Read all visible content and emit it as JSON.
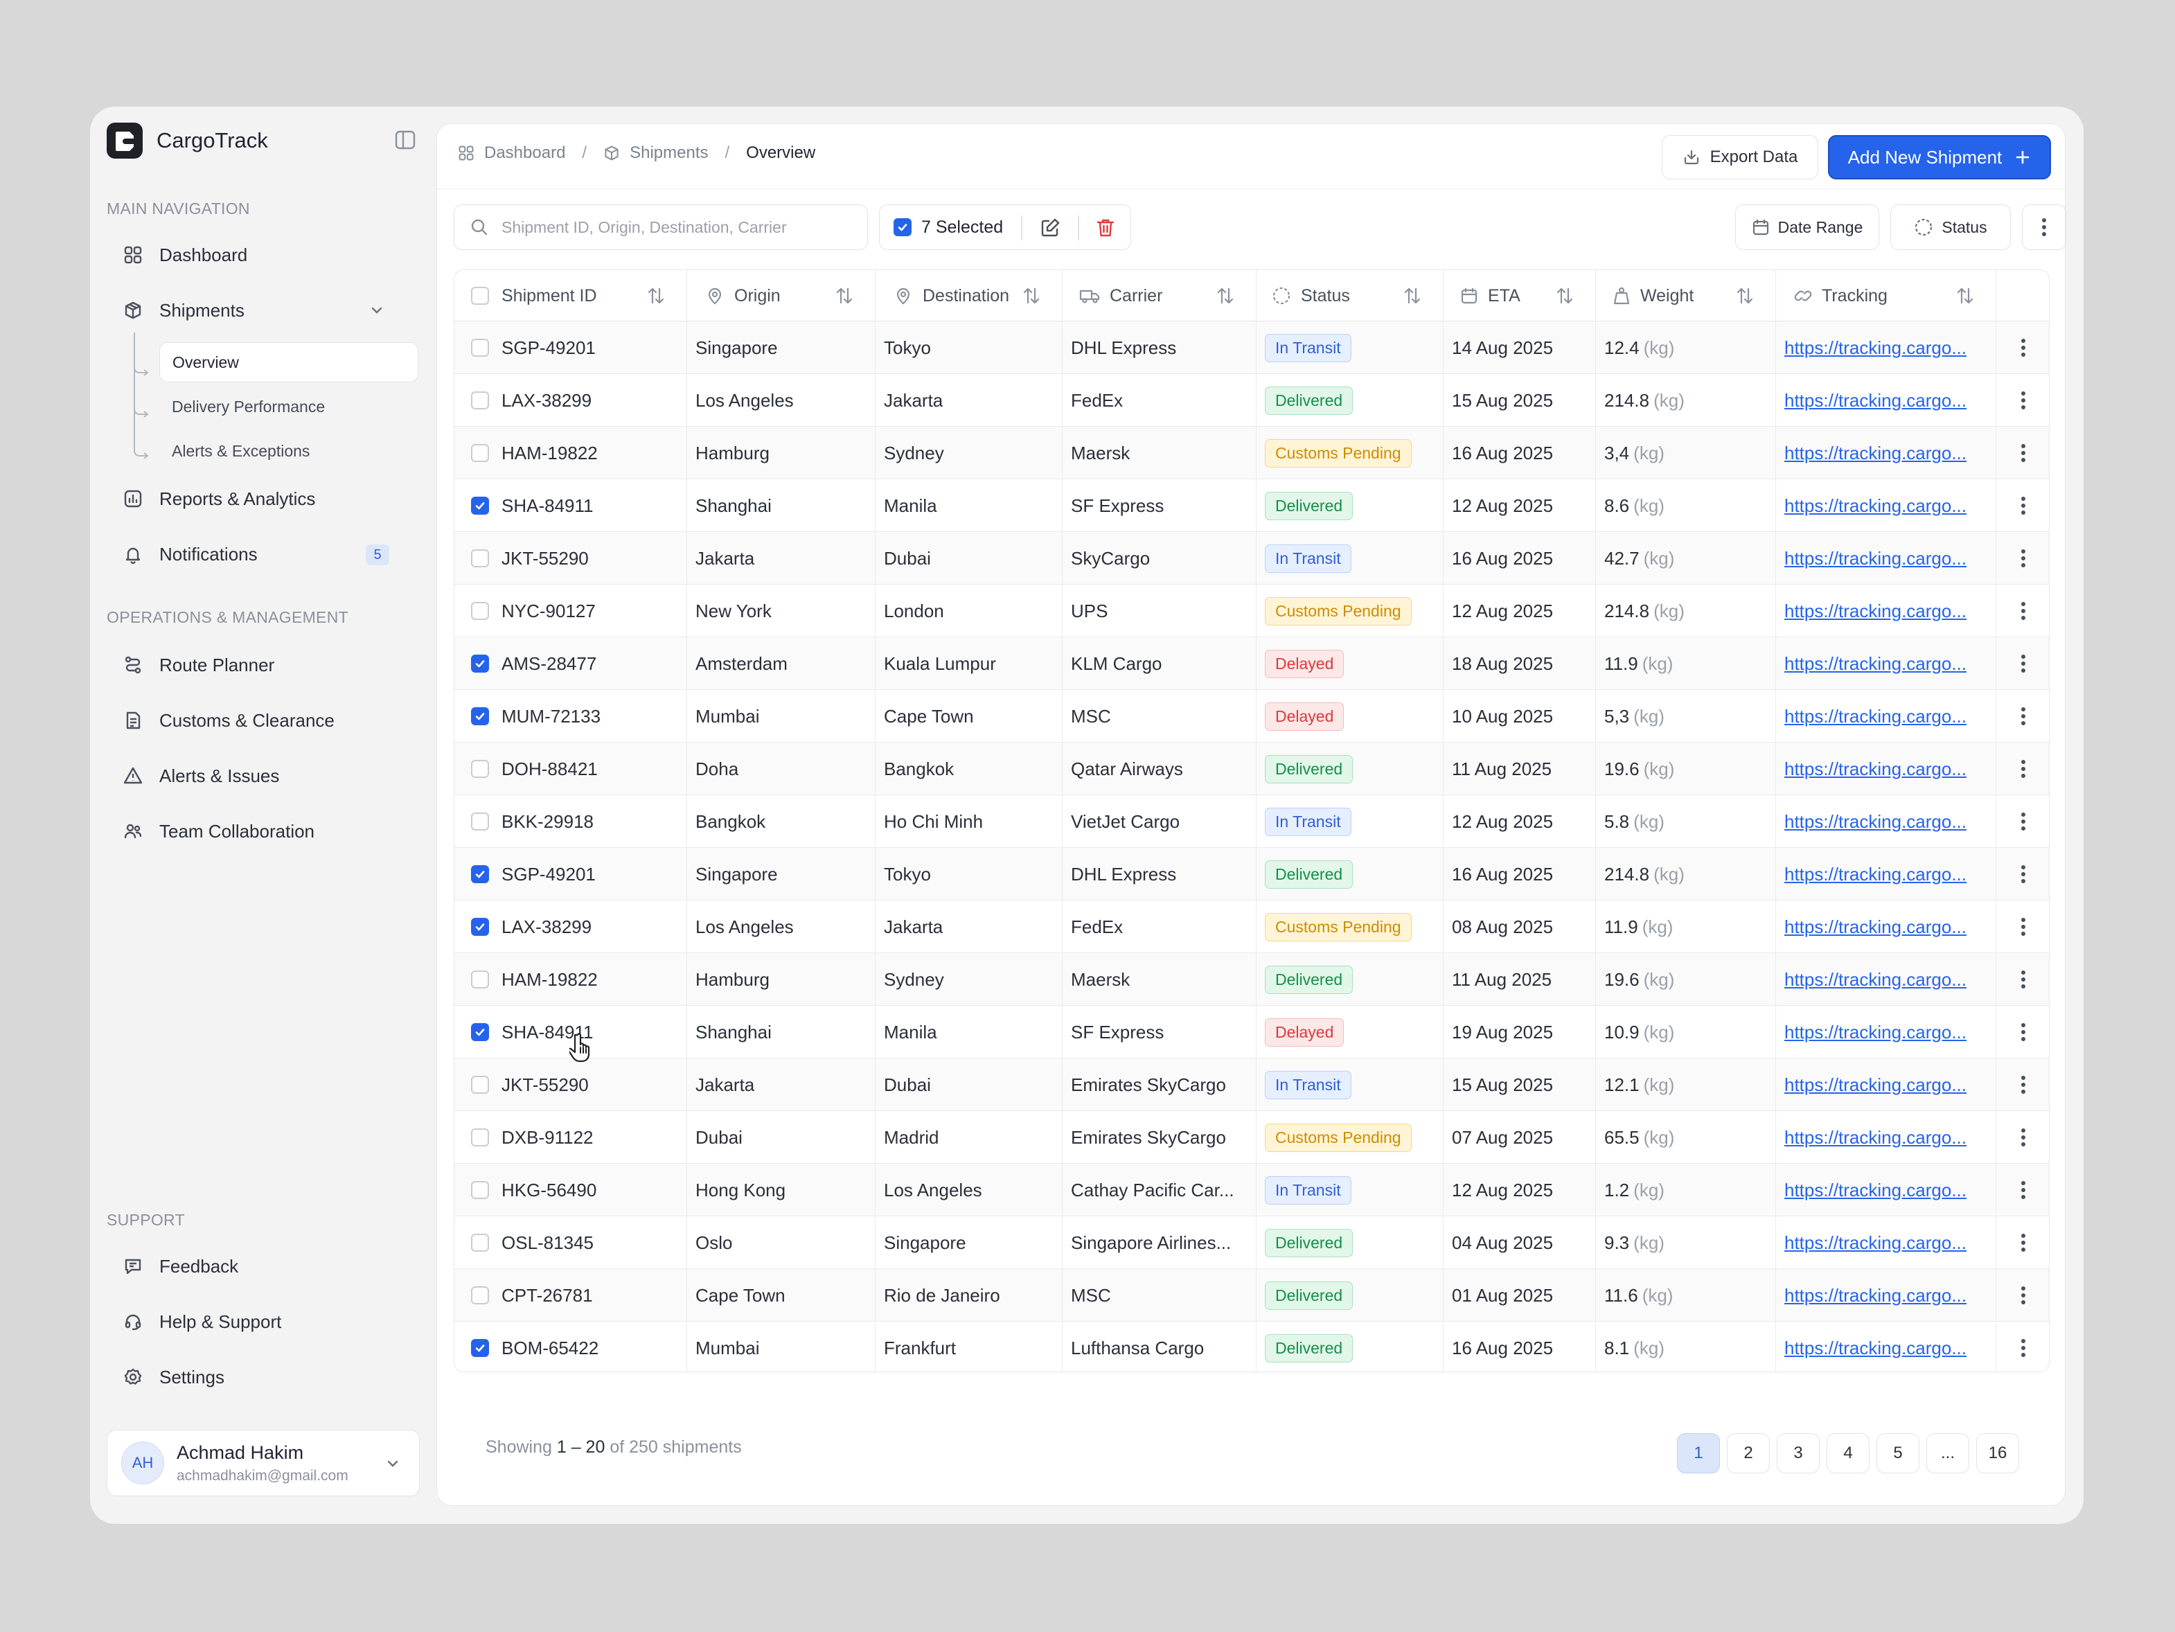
{
  "app": {
    "name": "CargoTrack"
  },
  "sidebar": {
    "main_nav_title": "MAIN NAVIGATION",
    "main_items": [
      {
        "label": "Dashboard",
        "icon": "grid-icon"
      },
      {
        "label": "Shipments",
        "icon": "package-icon"
      },
      {
        "label": "Reports & Analytics",
        "icon": "chart-icon"
      },
      {
        "label": "Notifications",
        "icon": "bell-icon",
        "badge": "5"
      }
    ],
    "shipments_sub": [
      {
        "label": "Overview",
        "active": true
      },
      {
        "label": "Delivery Performance"
      },
      {
        "label": "Alerts & Exceptions"
      }
    ],
    "ops_title": "OPERATIONS & MANAGEMENT",
    "ops_items": [
      {
        "label": "Route Planner",
        "icon": "route-icon"
      },
      {
        "label": "Customs & Clearance",
        "icon": "document-icon"
      },
      {
        "label": "Alerts & Issues",
        "icon": "warning-icon"
      },
      {
        "label": "Team Collaboration",
        "icon": "users-icon"
      }
    ],
    "support_title": "SUPPORT",
    "support_items": [
      {
        "label": "Feedback",
        "icon": "message-icon"
      },
      {
        "label": "Help & Support",
        "icon": "headset-icon"
      },
      {
        "label": "Settings",
        "icon": "gear-icon"
      }
    ],
    "profile": {
      "initials": "AH",
      "name": "Achmad Hakim",
      "email": "achmadhakim@gmail.com"
    }
  },
  "header": {
    "breadcrumb": [
      "Dashboard",
      "Shipments",
      "Overview"
    ],
    "export_label": "Export Data",
    "add_label": "Add New Shipment"
  },
  "toolbar": {
    "search_placeholder": "Shipment ID, Origin, Destination, Carrier",
    "selected_label": "7 Selected",
    "date_range_label": "Date Range",
    "status_label": "Status"
  },
  "table": {
    "columns": [
      "Shipment ID",
      "Origin",
      "Destination",
      "Carrier",
      "Status",
      "ETA",
      "Weight",
      "Tracking"
    ],
    "rows": [
      {
        "checked": false,
        "id": "SGP-49201",
        "origin": "Singapore",
        "dest": "Tokyo",
        "carrier": "DHL Express",
        "status": "In Transit",
        "eta": "14 Aug 2025",
        "weight": "12.4",
        "unit": "(kg)",
        "tracking": "https://tracking.cargo..."
      },
      {
        "checked": false,
        "id": "LAX-38299",
        "origin": "Los Angeles",
        "dest": "Jakarta",
        "carrier": "FedEx",
        "status": "Delivered",
        "eta": "15 Aug 2025",
        "weight": "214.8",
        "unit": "(kg)",
        "tracking": "https://tracking.cargo..."
      },
      {
        "checked": false,
        "id": "HAM-19822",
        "origin": "Hamburg",
        "dest": "Sydney",
        "carrier": "Maersk",
        "status": "Customs Pending",
        "eta": "16 Aug 2025",
        "weight": "3,4",
        "unit": "(kg)",
        "tracking": "https://tracking.cargo..."
      },
      {
        "checked": true,
        "id": "SHA-84911",
        "origin": "Shanghai",
        "dest": "Manila",
        "carrier": "SF Express",
        "status": "Delivered",
        "eta": "12 Aug 2025",
        "weight": "8.6",
        "unit": "(kg)",
        "tracking": "https://tracking.cargo..."
      },
      {
        "checked": false,
        "id": "JKT-55290",
        "origin": "Jakarta",
        "dest": "Dubai",
        "carrier": "SkyCargo",
        "status": "In Transit",
        "eta": "16 Aug 2025",
        "weight": "42.7",
        "unit": "(kg)",
        "tracking": "https://tracking.cargo..."
      },
      {
        "checked": false,
        "id": "NYC-90127",
        "origin": "New York",
        "dest": "London",
        "carrier": "UPS",
        "status": "Customs Pending",
        "eta": "12 Aug 2025",
        "weight": "214.8",
        "unit": "(kg)",
        "tracking": "https://tracking.cargo..."
      },
      {
        "checked": true,
        "id": "AMS-28477",
        "origin": "Amsterdam",
        "dest": "Kuala Lumpur",
        "carrier": "KLM Cargo",
        "status": "Delayed",
        "eta": "18 Aug 2025",
        "weight": "11.9",
        "unit": "(kg)",
        "tracking": "https://tracking.cargo..."
      },
      {
        "checked": true,
        "id": "MUM-72133",
        "origin": "Mumbai",
        "dest": "Cape Town",
        "carrier": "MSC",
        "status": "Delayed",
        "eta": "10 Aug 2025",
        "weight": "5,3",
        "unit": "(kg)",
        "tracking": "https://tracking.cargo..."
      },
      {
        "checked": false,
        "id": "DOH-88421",
        "origin": "Doha",
        "dest": "Bangkok",
        "carrier": "Qatar Airways",
        "status": "Delivered",
        "eta": "11 Aug 2025",
        "weight": "19.6",
        "unit": "(kg)",
        "tracking": "https://tracking.cargo..."
      },
      {
        "checked": false,
        "id": "BKK-29918",
        "origin": "Bangkok",
        "dest": "Ho Chi Minh",
        "carrier": "VietJet Cargo",
        "status": "In Transit",
        "eta": "12 Aug 2025",
        "weight": "5.8",
        "unit": "(kg)",
        "tracking": "https://tracking.cargo..."
      },
      {
        "checked": true,
        "id": "SGP-49201",
        "origin": "Singapore",
        "dest": "Tokyo",
        "carrier": "DHL Express",
        "status": "Delivered",
        "eta": "16 Aug 2025",
        "weight": "214.8",
        "unit": "(kg)",
        "tracking": "https://tracking.cargo..."
      },
      {
        "checked": true,
        "id": "LAX-38299",
        "origin": "Los Angeles",
        "dest": "Jakarta",
        "carrier": "FedEx",
        "status": "Customs Pending",
        "eta": "08 Aug 2025",
        "weight": "11.9",
        "unit": "(kg)",
        "tracking": "https://tracking.cargo..."
      },
      {
        "checked": false,
        "id": "HAM-19822",
        "origin": "Hamburg",
        "dest": "Sydney",
        "carrier": "Maersk",
        "status": "Delivered",
        "eta": "11 Aug 2025",
        "weight": "19.6",
        "unit": "(kg)",
        "tracking": "https://tracking.cargo..."
      },
      {
        "checked": true,
        "id": "SHA-84911",
        "origin": "Shanghai",
        "dest": "Manila",
        "carrier": "SF Express",
        "status": "Delayed",
        "eta": "19 Aug 2025",
        "weight": "10.9",
        "unit": "(kg)",
        "tracking": "https://tracking.cargo..."
      },
      {
        "checked": false,
        "id": "JKT-55290",
        "origin": "Jakarta",
        "dest": "Dubai",
        "carrier": "Emirates SkyCargo",
        "status": "In Transit",
        "eta": "15 Aug 2025",
        "weight": "12.1",
        "unit": "(kg)",
        "tracking": "https://tracking.cargo..."
      },
      {
        "checked": false,
        "id": "DXB-91122",
        "origin": "Dubai",
        "dest": "Madrid",
        "carrier": "Emirates SkyCargo",
        "status": "Customs Pending",
        "eta": "07 Aug 2025",
        "weight": "65.5",
        "unit": "(kg)",
        "tracking": "https://tracking.cargo..."
      },
      {
        "checked": false,
        "id": "HKG-56490",
        "origin": "Hong Kong",
        "dest": "Los Angeles",
        "carrier": "Cathay Pacific Car...",
        "status": "In Transit",
        "eta": "12 Aug 2025",
        "weight": "1.2",
        "unit": "(kg)",
        "tracking": "https://tracking.cargo..."
      },
      {
        "checked": false,
        "id": "OSL-81345",
        "origin": "Oslo",
        "dest": "Singapore",
        "carrier": "Singapore Airlines...",
        "status": "Delivered",
        "eta": "04 Aug 2025",
        "weight": "9.3",
        "unit": "(kg)",
        "tracking": "https://tracking.cargo..."
      },
      {
        "checked": false,
        "id": "CPT-26781",
        "origin": "Cape Town",
        "dest": "Rio de Janeiro",
        "carrier": "MSC",
        "status": "Delivered",
        "eta": "01 Aug 2025",
        "weight": "11.6",
        "unit": "(kg)",
        "tracking": "https://tracking.cargo..."
      },
      {
        "checked": true,
        "id": "BOM-65422",
        "origin": "Mumbai",
        "dest": "Frankfurt",
        "carrier": "Lufthansa Cargo",
        "status": "Delivered",
        "eta": "16 Aug 2025",
        "weight": "8.1",
        "unit": "(kg)",
        "tracking": "https://tracking.cargo..."
      }
    ]
  },
  "footer": {
    "showing_prefix": "Showing",
    "range": "1 – 20",
    "of_text": "of 250 shipments",
    "pages": [
      "1",
      "2",
      "3",
      "4",
      "5",
      "...",
      "16"
    ],
    "current_page": "1"
  },
  "colors": {
    "accent": "#2563eb",
    "transit": "#2f5fd6",
    "delivered": "#149049",
    "customs": "#d08b00",
    "delayed": "#dc3a3a"
  }
}
